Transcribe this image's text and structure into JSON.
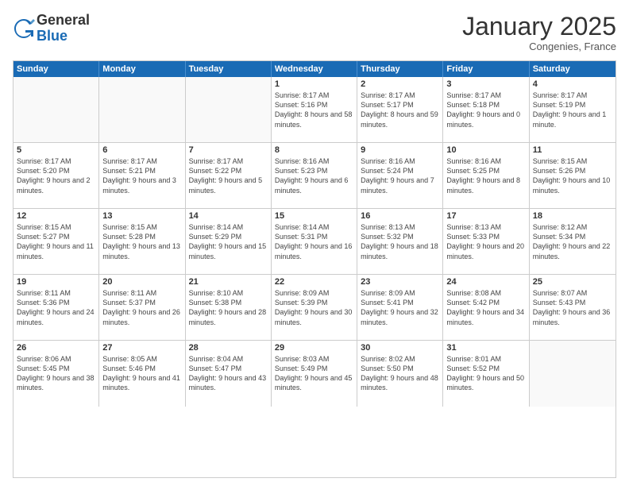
{
  "header": {
    "logo_line1": "General",
    "logo_line2": "Blue",
    "month": "January 2025",
    "location": "Congenies, France"
  },
  "days_of_week": [
    "Sunday",
    "Monday",
    "Tuesday",
    "Wednesday",
    "Thursday",
    "Friday",
    "Saturday"
  ],
  "weeks": [
    [
      {
        "day": "",
        "empty": true
      },
      {
        "day": "",
        "empty": true
      },
      {
        "day": "",
        "empty": true
      },
      {
        "day": "1",
        "sunrise": "8:17 AM",
        "sunset": "5:16 PM",
        "daylight": "8 hours and 58 minutes."
      },
      {
        "day": "2",
        "sunrise": "8:17 AM",
        "sunset": "5:17 PM",
        "daylight": "8 hours and 59 minutes."
      },
      {
        "day": "3",
        "sunrise": "8:17 AM",
        "sunset": "5:18 PM",
        "daylight": "9 hours and 0 minutes."
      },
      {
        "day": "4",
        "sunrise": "8:17 AM",
        "sunset": "5:19 PM",
        "daylight": "9 hours and 1 minute."
      }
    ],
    [
      {
        "day": "5",
        "sunrise": "8:17 AM",
        "sunset": "5:20 PM",
        "daylight": "9 hours and 2 minutes."
      },
      {
        "day": "6",
        "sunrise": "8:17 AM",
        "sunset": "5:21 PM",
        "daylight": "9 hours and 3 minutes."
      },
      {
        "day": "7",
        "sunrise": "8:17 AM",
        "sunset": "5:22 PM",
        "daylight": "9 hours and 5 minutes."
      },
      {
        "day": "8",
        "sunrise": "8:16 AM",
        "sunset": "5:23 PM",
        "daylight": "9 hours and 6 minutes."
      },
      {
        "day": "9",
        "sunrise": "8:16 AM",
        "sunset": "5:24 PM",
        "daylight": "9 hours and 7 minutes."
      },
      {
        "day": "10",
        "sunrise": "8:16 AM",
        "sunset": "5:25 PM",
        "daylight": "9 hours and 8 minutes."
      },
      {
        "day": "11",
        "sunrise": "8:15 AM",
        "sunset": "5:26 PM",
        "daylight": "9 hours and 10 minutes."
      }
    ],
    [
      {
        "day": "12",
        "sunrise": "8:15 AM",
        "sunset": "5:27 PM",
        "daylight": "9 hours and 11 minutes."
      },
      {
        "day": "13",
        "sunrise": "8:15 AM",
        "sunset": "5:28 PM",
        "daylight": "9 hours and 13 minutes."
      },
      {
        "day": "14",
        "sunrise": "8:14 AM",
        "sunset": "5:29 PM",
        "daylight": "9 hours and 15 minutes."
      },
      {
        "day": "15",
        "sunrise": "8:14 AM",
        "sunset": "5:31 PM",
        "daylight": "9 hours and 16 minutes."
      },
      {
        "day": "16",
        "sunrise": "8:13 AM",
        "sunset": "5:32 PM",
        "daylight": "9 hours and 18 minutes."
      },
      {
        "day": "17",
        "sunrise": "8:13 AM",
        "sunset": "5:33 PM",
        "daylight": "9 hours and 20 minutes."
      },
      {
        "day": "18",
        "sunrise": "8:12 AM",
        "sunset": "5:34 PM",
        "daylight": "9 hours and 22 minutes."
      }
    ],
    [
      {
        "day": "19",
        "sunrise": "8:11 AM",
        "sunset": "5:36 PM",
        "daylight": "9 hours and 24 minutes."
      },
      {
        "day": "20",
        "sunrise": "8:11 AM",
        "sunset": "5:37 PM",
        "daylight": "9 hours and 26 minutes."
      },
      {
        "day": "21",
        "sunrise": "8:10 AM",
        "sunset": "5:38 PM",
        "daylight": "9 hours and 28 minutes."
      },
      {
        "day": "22",
        "sunrise": "8:09 AM",
        "sunset": "5:39 PM",
        "daylight": "9 hours and 30 minutes."
      },
      {
        "day": "23",
        "sunrise": "8:09 AM",
        "sunset": "5:41 PM",
        "daylight": "9 hours and 32 minutes."
      },
      {
        "day": "24",
        "sunrise": "8:08 AM",
        "sunset": "5:42 PM",
        "daylight": "9 hours and 34 minutes."
      },
      {
        "day": "25",
        "sunrise": "8:07 AM",
        "sunset": "5:43 PM",
        "daylight": "9 hours and 36 minutes."
      }
    ],
    [
      {
        "day": "26",
        "sunrise": "8:06 AM",
        "sunset": "5:45 PM",
        "daylight": "9 hours and 38 minutes."
      },
      {
        "day": "27",
        "sunrise": "8:05 AM",
        "sunset": "5:46 PM",
        "daylight": "9 hours and 41 minutes."
      },
      {
        "day": "28",
        "sunrise": "8:04 AM",
        "sunset": "5:47 PM",
        "daylight": "9 hours and 43 minutes."
      },
      {
        "day": "29",
        "sunrise": "8:03 AM",
        "sunset": "5:49 PM",
        "daylight": "9 hours and 45 minutes."
      },
      {
        "day": "30",
        "sunrise": "8:02 AM",
        "sunset": "5:50 PM",
        "daylight": "9 hours and 48 minutes."
      },
      {
        "day": "31",
        "sunrise": "8:01 AM",
        "sunset": "5:52 PM",
        "daylight": "9 hours and 50 minutes."
      },
      {
        "day": "",
        "empty": true
      }
    ]
  ],
  "labels": {
    "sunrise_prefix": "Sunrise:",
    "sunset_prefix": "Sunset:",
    "daylight_prefix": "Daylight:"
  }
}
